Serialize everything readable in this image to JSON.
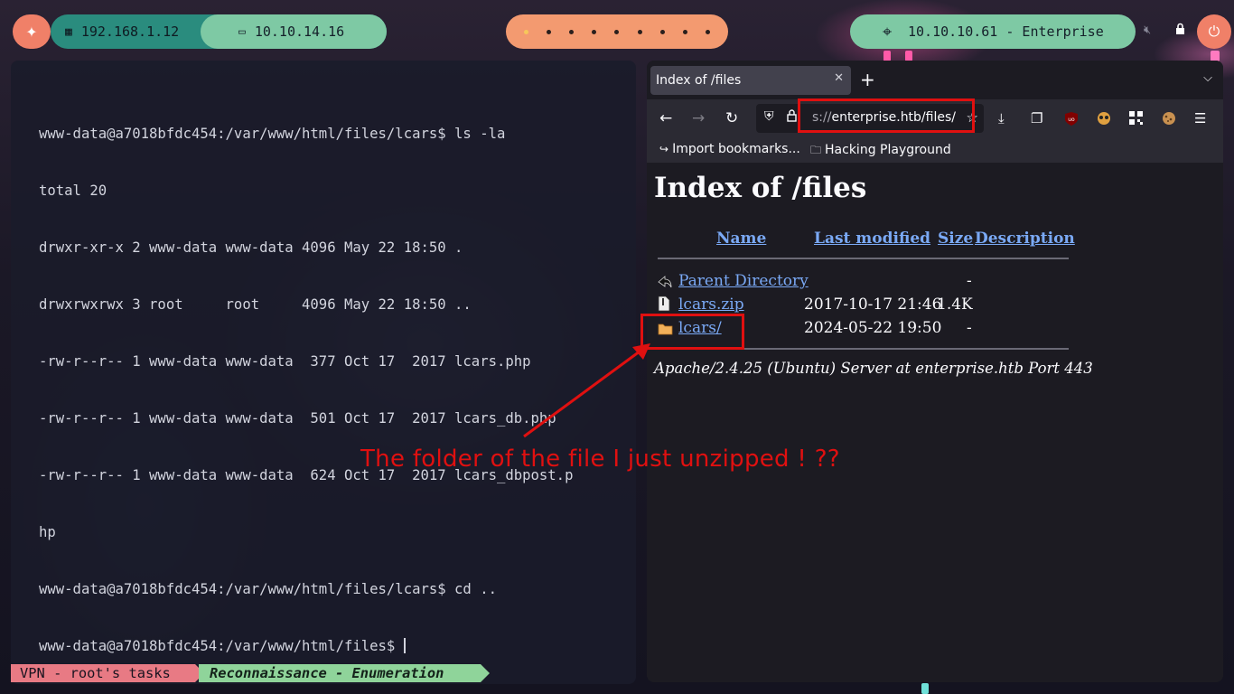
{
  "topbar": {
    "local_ip": "192.168.1.12",
    "vpn_ip": "10.10.14.16",
    "target": "10.10.10.61 - Enterprise",
    "workspaces": 9,
    "active_workspace": 1
  },
  "terminal": {
    "lines": [
      "www-data@a7018bfdc454:/var/www/html/files/lcars$ ls -la",
      "total 20",
      "drwxr-xr-x 2 www-data www-data 4096 May 22 18:50 .",
      "drwxrwxrwx 3 root     root     4096 May 22 18:50 ..",
      "-rw-r--r-- 1 www-data www-data  377 Oct 17  2017 lcars.php",
      "-rw-r--r-- 1 www-data www-data  501 Oct 17  2017 lcars_db.php",
      "-rw-r--r-- 1 www-data www-data  624 Oct 17  2017 lcars_dbpost.p",
      "hp",
      "www-data@a7018bfdc454:/var/www/html/files/lcars$ cd ..",
      "www-data@a7018bfdc454:/var/www/html/files$ "
    ],
    "status_tasks": "VPN - root's tasks",
    "status_phase": "Reconnaissance - Enumeration"
  },
  "browser": {
    "tab_title": "Index of /files",
    "url_scheme": "s://",
    "url_host_path": "enterprise.htb/files/",
    "bookmarks": [
      "Import bookmarks...",
      "Hacking Playground"
    ],
    "page": {
      "heading": "Index of /files",
      "columns": [
        "Name",
        "Last modified",
        "Size",
        "Description"
      ],
      "rows": [
        {
          "name": "Parent Directory",
          "modified": "",
          "size": "-",
          "icon": "back-icon"
        },
        {
          "name": "lcars.zip",
          "modified": "2017-10-17 21:46",
          "size": "1.4K",
          "icon": "file-icon"
        },
        {
          "name": "lcars/",
          "modified": "2024-05-22 19:50",
          "size": "-",
          "icon": "folder-icon"
        }
      ],
      "address": "Apache/2.4.25 (Ubuntu) Server at enterprise.htb Port 443"
    }
  },
  "annotation": {
    "text": "The folder of the file I just unzipped ! ??",
    "color": "#e01010"
  }
}
